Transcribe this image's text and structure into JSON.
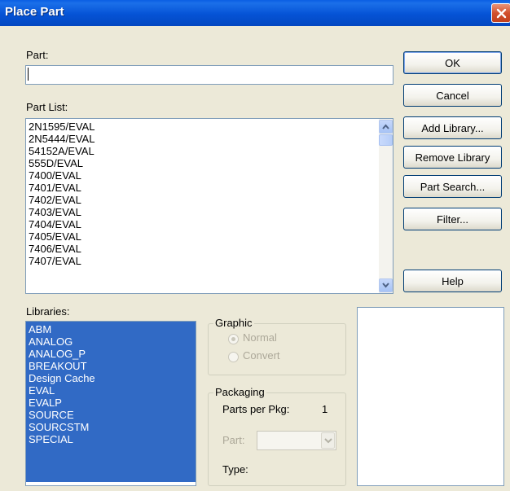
{
  "window": {
    "title": "Place Part"
  },
  "part": {
    "label": "Part:",
    "value": ""
  },
  "part_list": {
    "label": "Part List:",
    "items": [
      "2N1595/EVAL",
      "2N5444/EVAL",
      "54152A/EVAL",
      "555D/EVAL",
      "7400/EVAL",
      "7401/EVAL",
      "7402/EVAL",
      "7403/EVAL",
      "7404/EVAL",
      "7405/EVAL",
      "7406/EVAL",
      "7407/EVAL"
    ]
  },
  "buttons": {
    "ok": "OK",
    "cancel": "Cancel",
    "add_library": "Add Library...",
    "remove_library": "Remove Library",
    "part_search": "Part Search...",
    "filter": "Filter...",
    "help": "Help"
  },
  "libraries": {
    "label": "Libraries:",
    "items": [
      "ABM",
      "ANALOG",
      "ANALOG_P",
      "BREAKOUT",
      "Design Cache",
      "EVAL",
      "EVALP",
      "SOURCE",
      "SOURCSTM",
      "SPECIAL"
    ],
    "selection_color": "#316ac5"
  },
  "graphic": {
    "label": "Graphic",
    "normal": "Normal",
    "convert": "Convert",
    "selected": "Normal"
  },
  "packaging": {
    "label": "Packaging",
    "parts_per_pkg_label": "Parts per Pkg:",
    "parts_per_pkg_value": "1",
    "part_label": "Part:",
    "part_value": "",
    "type_label": "Type:",
    "type_value": ""
  },
  "colors": {
    "titlebar": "#0553d6",
    "dialog_bg": "#ece9d8",
    "close_button": "#d2502d"
  }
}
